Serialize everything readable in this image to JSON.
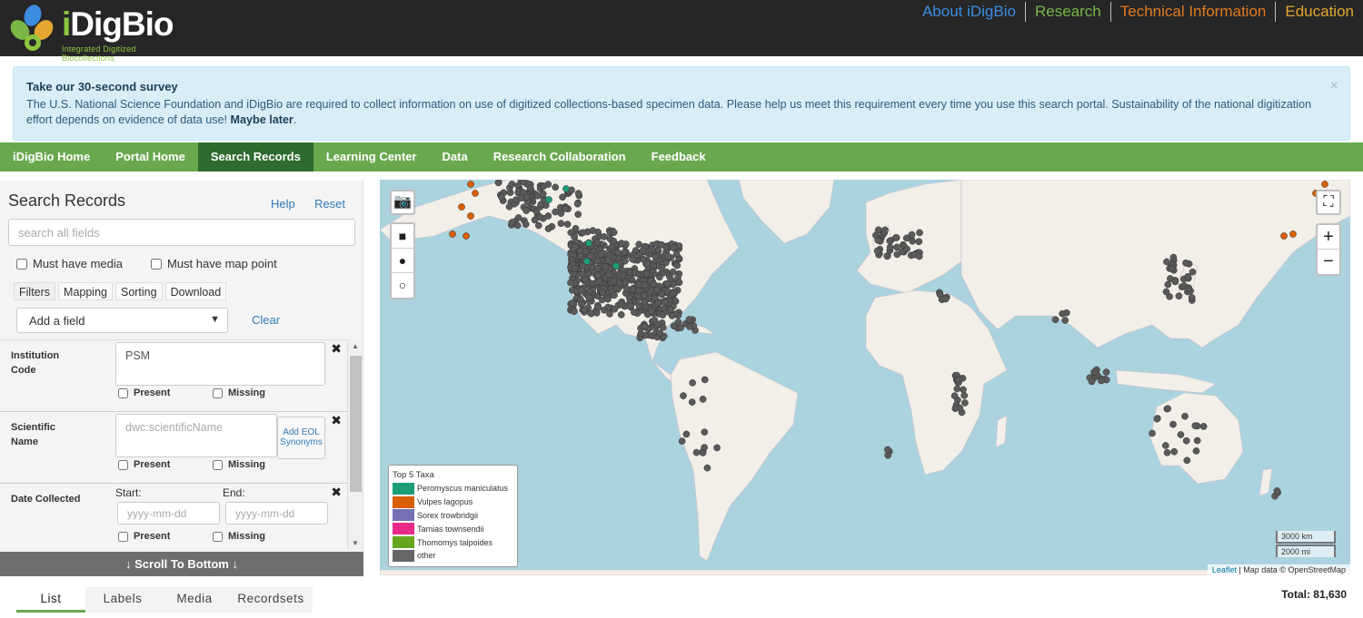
{
  "header": {
    "logo_word": "iDigBio",
    "logo_tagline": "Integrated Digitized Biocollections",
    "nav": [
      {
        "label": "About iDigBio",
        "color": "#3b8de0"
      },
      {
        "label": "Research",
        "color": "#7ab648"
      },
      {
        "label": "Technical Information",
        "color": "#e07b22"
      },
      {
        "label": "Education",
        "color": "#e3a72f"
      }
    ]
  },
  "survey": {
    "title": "Take our 30-second survey",
    "body": "The U.S. National Science Foundation and iDigBio are required to collect information on use of digitized collections-based specimen data. Please help us meet this requirement every time you use this search portal. Sustainability of the national digitization effort depends on evidence of data use! ",
    "later": "Maybe later",
    "close": "×"
  },
  "mainnav": [
    {
      "label": "iDigBio Home"
    },
    {
      "label": "Portal Home"
    },
    {
      "label": "Search Records"
    },
    {
      "label": "Learning Center"
    },
    {
      "label": "Data"
    },
    {
      "label": "Research Collaboration"
    },
    {
      "label": "Feedback"
    }
  ],
  "search": {
    "title": "Search Records",
    "help": "Help",
    "reset": "Reset",
    "placeholder": "search all fields",
    "must_media": "Must have media",
    "must_map": "Must have map point",
    "tabs": [
      "Filters",
      "Mapping",
      "Sorting",
      "Download"
    ],
    "add_field": "Add a field",
    "clear": "Clear",
    "filters": {
      "institution": {
        "label": "Institution Code",
        "value": "PSM",
        "present": "Present",
        "missing": "Missing"
      },
      "scientific": {
        "label": "Scientific Name",
        "placeholder": "dwc:scientificName",
        "add_synonyms": "Add EOL Synonyms",
        "present": "Present",
        "missing": "Missing"
      },
      "date": {
        "label": "Date Collected",
        "start": "Start:",
        "end": "End:",
        "start_ph": "yyyy-mm-dd",
        "end_ph": "yyyy-mm-dd",
        "present": "Present",
        "missing": "Missing"
      }
    },
    "scroll_bottom": "↓ Scroll To Bottom ↓"
  },
  "bottom_tabs": [
    "List",
    "Labels",
    "Media",
    "Recordsets"
  ],
  "total": "Total: 81,630",
  "map": {
    "legend_title": "Top 5 Taxa",
    "legend": [
      {
        "name": "Peromyscus maniculatus",
        "color": "#1b9e77"
      },
      {
        "name": "Vulpes lagopus",
        "color": "#d95f02"
      },
      {
        "name": "Sorex trowbridgii",
        "color": "#7570b3"
      },
      {
        "name": "Tamias townsendii",
        "color": "#e7298a"
      },
      {
        "name": "Thomomys talpoides",
        "color": "#66a61e"
      },
      {
        "name": "other",
        "color": "#666666"
      }
    ],
    "scale_km": "3000 km",
    "scale_mi": "2000 mi",
    "attribution_leaflet": "Leaflet",
    "attribution_rest": " | Map data © OpenStreetMap",
    "zoom_in": "+",
    "zoom_out": "−"
  }
}
